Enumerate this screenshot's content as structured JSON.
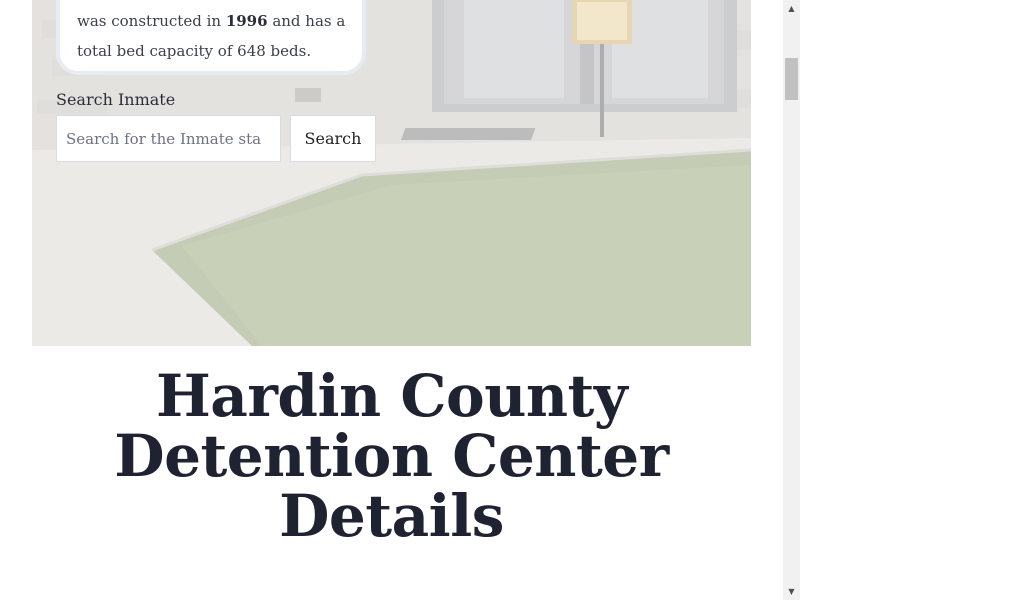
{
  "info": {
    "line1_prefix": "was constructed in ",
    "year": "1996",
    "line1_suffix": " and has a",
    "line2": "total bed capacity of 648 beds."
  },
  "search": {
    "label": "Search Inmate",
    "placeholder": "Search for the Inmate sta",
    "button_label": "Search"
  },
  "page": {
    "title_line1": "Hardin County",
    "title_line2": "Detention Center",
    "title_line3": "Details"
  },
  "scrollbar": {
    "up_icon": "▲",
    "down_icon": "▼"
  },
  "colors": {
    "title": "#1e2231",
    "card_border": "#e6ecf1"
  }
}
